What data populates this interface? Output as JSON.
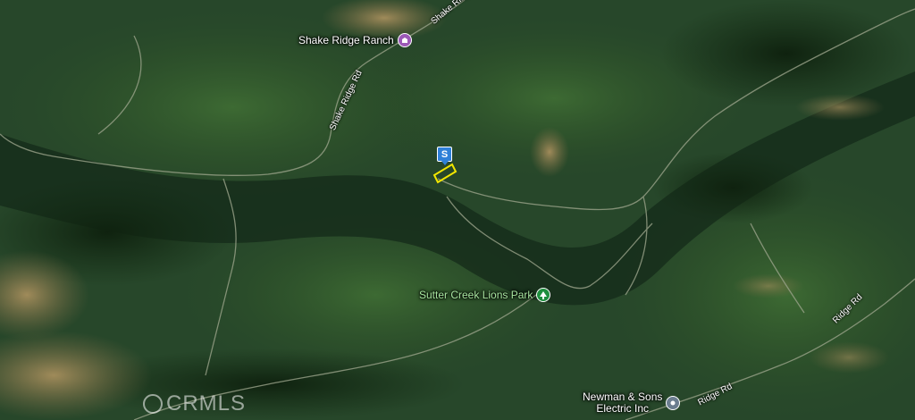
{
  "map": {
    "view": "satellite",
    "pois": [
      {
        "label": "Shake Ridge Ranch",
        "icon": "building-icon",
        "color": "#9b59b6"
      },
      {
        "label": "Sutter Creek Lions Park",
        "icon": "tree-icon",
        "color": "#1e8e3e"
      },
      {
        "label": "Newman & Sons\nElectric Inc",
        "icon": "business-icon",
        "color": "#6b7d8f"
      }
    ],
    "roads": [
      {
        "label": "Shake Ridge Rd"
      },
      {
        "label": "Shake Ridge Rd"
      },
      {
        "label": "Ridge Rd"
      },
      {
        "label": "Ridge Rd"
      }
    ],
    "marker": {
      "label": "S",
      "color": "#2f80d8"
    },
    "parcel": {
      "outline_color": "#f2e600"
    },
    "watermark": "CRMLS"
  }
}
